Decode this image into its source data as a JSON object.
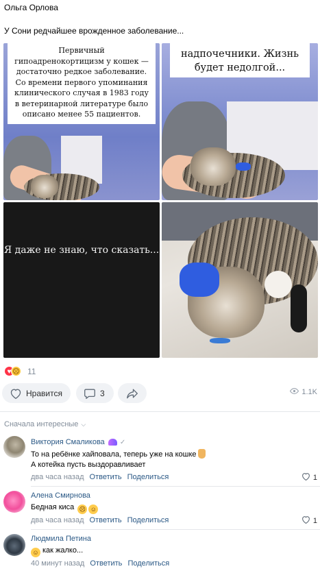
{
  "post": {
    "author": "Ольга Орлова",
    "text": "У Сони редчайшее врожденное заболевание..."
  },
  "photos": {
    "p1_caption": "Первичный гипоадренокортицизм у кошек — достаточно редкое заболевание. Со времени первого упоминания клинического случая в 1983 году в ветеринарной литературе было описано менее 55 пациентов.",
    "p2_caption": "надпочечники. Жизнь будет недолгой...",
    "p3_caption": "Я даже не знаю, что сказать..."
  },
  "reactions": {
    "icons": [
      "heart-reaction-icon",
      "crying-face-reaction-icon"
    ],
    "count": "11"
  },
  "actions": {
    "like_label": "Нравится",
    "comment_count": "3",
    "views": "1.1K"
  },
  "comments_header": {
    "sort_label": "Сначала интересные"
  },
  "comments": [
    {
      "name": "Виктория Смаликова",
      "line1": "То на ребёнке хайповала, теперь уже на кошке",
      "line2": "А котейка пусть выздоравливает",
      "time": "два часа назад",
      "reply": "Ответить",
      "share": "Поделиться",
      "likes": "1"
    },
    {
      "name": "Алена Смирнова",
      "line1": "Бедная киса",
      "time": "два часа назад",
      "reply": "Ответить",
      "share": "Поделиться",
      "likes": "1"
    },
    {
      "name": "Людмила Петина",
      "line1": "как жалко...",
      "time": "40 минут назад",
      "reply": "Ответить",
      "share": "Поделиться"
    }
  ],
  "colors": {
    "link": "#2a5885",
    "muted": "#818c99",
    "pill_bg": "#f0f2f5",
    "heart": "#ff3347"
  }
}
